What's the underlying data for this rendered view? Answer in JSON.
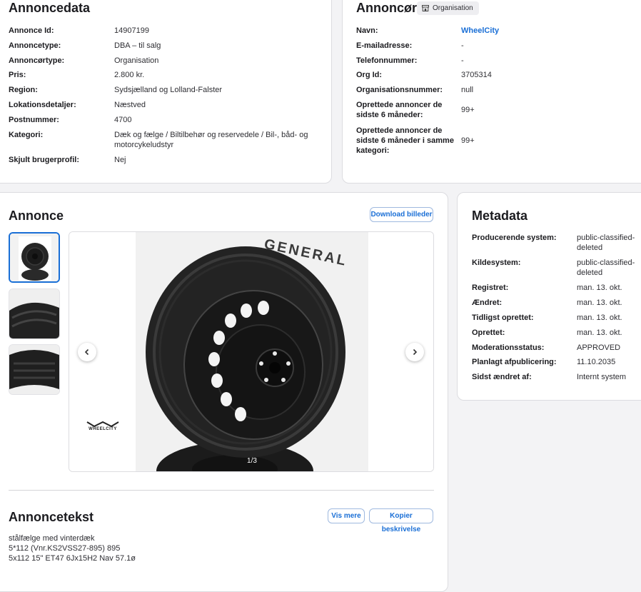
{
  "annoncedata": {
    "title": "Annoncedata",
    "rows": [
      {
        "label": "Annonce Id:",
        "value": "14907199"
      },
      {
        "label": "Annoncetype:",
        "value": "DBA – til salg"
      },
      {
        "label": "Annoncørtype:",
        "value": "Organisation"
      },
      {
        "label": "Pris:",
        "value": "2.800 kr."
      },
      {
        "label": "Region:",
        "value": "Sydsjælland og Lolland-Falster"
      },
      {
        "label": "Lokationsdetaljer:",
        "value": "Næstved"
      },
      {
        "label": "Postnummer:",
        "value": "4700"
      },
      {
        "label": "Kategori:",
        "value_line1": "Dæk og fælge / Biltilbehør og reservedele / Bil-, båd- og",
        "value_line2": "motorcykeludstyr"
      },
      {
        "label": "Skjult brugerprofil:",
        "value": "Nej"
      }
    ]
  },
  "annoncoer": {
    "title": "Annoncør",
    "badge": "Organisation",
    "rows": [
      {
        "label": "Navn:",
        "value": "WheelCity"
      },
      {
        "label": "E-mailadresse:",
        "value": "-"
      },
      {
        "label": "Telefonnummer:",
        "value": "-"
      },
      {
        "label": "Org Id:",
        "value": "3705314"
      },
      {
        "label": "Organisationsnummer:",
        "value": "null"
      },
      {
        "label_line1": "Oprettede annoncer de",
        "label_line2": "sidste 6 måneder:",
        "value": "99+"
      },
      {
        "label_line1": "Oprettede annoncer de",
        "label_line2": "sidste 6 måneder i samme",
        "label_line3": "kategori:",
        "value": "99+"
      }
    ]
  },
  "annonce": {
    "title": "Annonce",
    "download_label": "Download billeder",
    "counter": "1/3",
    "watermark": "WHEELCITY",
    "tire_brand": "GENERAL"
  },
  "annoncetekst": {
    "title": "Annoncetekst",
    "show_more_label": "Vis mere",
    "copy_label": "Kopier beskrivelse",
    "lines": [
      "stålfælge med vinterdæk",
      "5*112 (Vnr.KS2VSS27-895) 895",
      "5x112 15\" ET47 6Jx15H2 Nav 57.1ø"
    ]
  },
  "metadata": {
    "title": "Metadata",
    "rows": [
      {
        "label": "Producerende system:",
        "value_line1": "public-classified-",
        "value_line2": "deleted"
      },
      {
        "label": "Kildesystem:",
        "value_line1": "public-classified-",
        "value_line2": "deleted"
      },
      {
        "label": "Registret:",
        "value": "man. 13. okt."
      },
      {
        "label": "Ændret:",
        "value": "man. 13. okt."
      },
      {
        "label": "Tidligst oprettet:",
        "value": "man. 13. okt."
      },
      {
        "label": "Oprettet:",
        "value": "man. 13. okt."
      },
      {
        "label": "Moderationsstatus:",
        "value": "APPROVED"
      },
      {
        "label": "Planlagt afpublicering:",
        "value": "11.10.2035"
      },
      {
        "label": "Sidst ændret af:",
        "value": "Internt system"
      }
    ]
  },
  "colors": {
    "accent": "#1a6fd6",
    "background": "#f3f3f5",
    "card": "#ffffff"
  }
}
